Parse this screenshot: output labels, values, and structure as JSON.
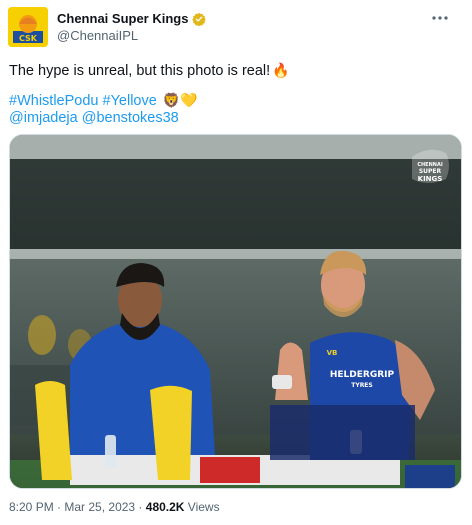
{
  "account": {
    "display_name": "Chennai Super Kings",
    "handle": "@ChennaiIPL",
    "verified_icon": "verified-badge-icon",
    "avatar_icon": "csk-logo-icon"
  },
  "tweet": {
    "text": "The hype is unreal, but this photo is real!",
    "text_emoji": "🔥",
    "hashtags": [
      "#WhistlePodu",
      "#Yellove"
    ],
    "hashtag_emojis": "🦁💛",
    "mentions": [
      "@imjadeja",
      "@benstokes38"
    ]
  },
  "photo": {
    "watermark_line1": "CHENNAI",
    "watermark_line2": "SUPER",
    "watermark_line3": "KINGS",
    "jersey_text1": "HELDERGRIP",
    "jersey_text2": "TYRES",
    "jersey_brand": "VB"
  },
  "footer": {
    "time": "8:20 PM",
    "separator": " · ",
    "date": "Mar 25, 2023",
    "views_count": "480.2K",
    "views_label": " Views"
  },
  "colors": {
    "link": "#1d9bf0",
    "text": "#0f1419",
    "muted": "#536471",
    "csk_yellow": "#f6d000"
  }
}
